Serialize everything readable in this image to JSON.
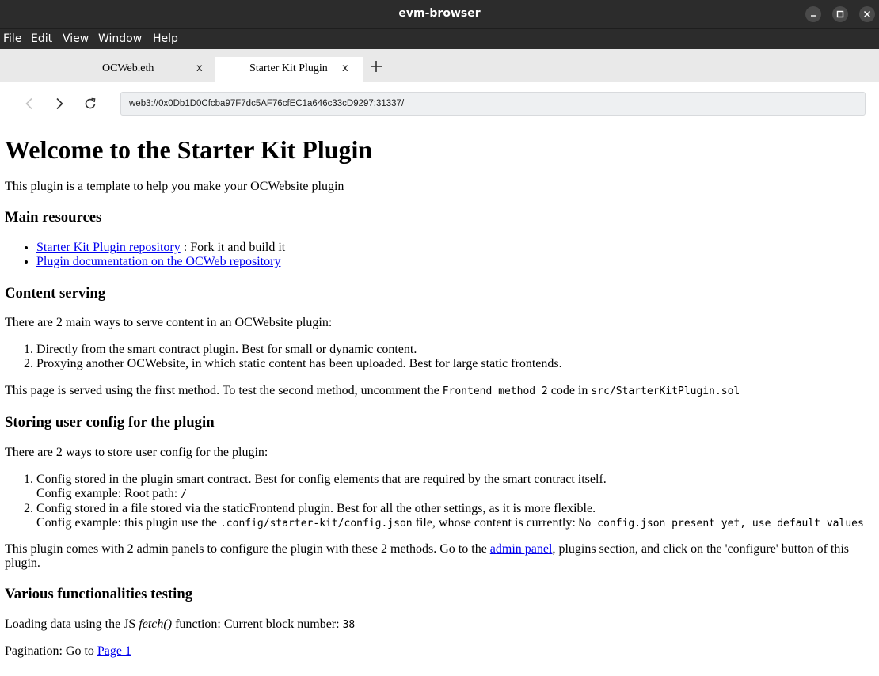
{
  "window": {
    "title": "evm-browser"
  },
  "menu": [
    "File",
    "Edit",
    "View",
    "Window",
    "Help"
  ],
  "tabs": [
    {
      "label": "OCWeb.eth",
      "close": "x"
    },
    {
      "label": "Starter Kit Plugin",
      "close": "x"
    }
  ],
  "nav": {
    "url": "web3://0x0Db1D0Cfcba97F7dc5AF76cfEC1a646c33cD9297:31337/"
  },
  "page": {
    "heading": "Welcome to the Starter Kit Plugin",
    "intro": "This plugin is a template to help you make your OCWebsite plugin",
    "main_resources": {
      "title": "Main resources",
      "item1_link": "Starter Kit Plugin repository",
      "item1_text": " : Fork it and build it",
      "item2_link": "Plugin documentation on the OCWeb repository"
    },
    "content_serving": {
      "title": "Content serving",
      "intro": "There are 2 main ways to serve content in an OCWebsite plugin:",
      "item1": "Directly from the smart contract plugin. Best for small or dynamic content.",
      "item2": "Proxying another OCWebsite, in which static content has been uploaded. Best for large static frontends.",
      "note_a": "This page is served using the first method. To test the second method, uncomment the ",
      "note_code1": "Frontend method 2",
      "note_b": " code in ",
      "note_code2": "src/StarterKitPlugin.sol"
    },
    "user_config": {
      "title": "Storing user config for the plugin",
      "intro": "There are 2 ways to store user config for the plugin:",
      "item1_line1": "Config stored in the plugin smart contract. Best for config elements that are required by the smart contract itself.",
      "item1_line2": "Config example: Root path: ",
      "item1_code": "/",
      "item2_line1": "Config stored in a file stored via the staticFrontend plugin. Best for all the other settings, as it is more flexible.",
      "item2_line2a": "Config example: this plugin use the ",
      "item2_code1": ".config/starter-kit/config.json",
      "item2_line2b": " file, whose content is currently: ",
      "item2_code2": "No config.json present yet, use default values",
      "admin_a": "This plugin comes with 2 admin panels to configure the plugin with these 2 methods. Go to the ",
      "admin_link": "admin panel",
      "admin_b": ", plugins section, and click on the 'configure' button of this",
      "admin_c": "plugin."
    },
    "functionalities": {
      "title": "Various functionalities testing",
      "fetch_a": "Loading data using the JS ",
      "fetch_fn": "fetch()",
      "fetch_b": " function: Current block number: ",
      "block_number": "38",
      "pagination_a": "Pagination: Go to ",
      "pagination_link": "Page 1"
    }
  }
}
